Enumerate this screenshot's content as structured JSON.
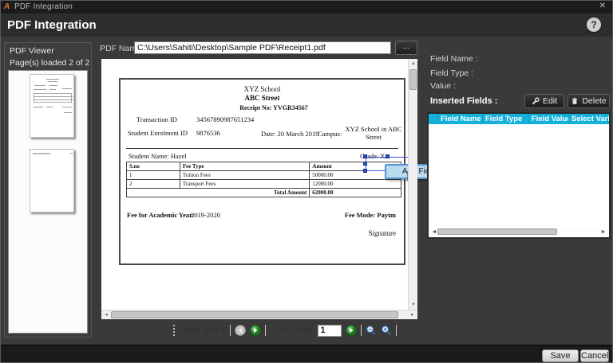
{
  "window": {
    "title": "PDF Integration",
    "close_glyph": "✕"
  },
  "header": {
    "title": "PDF Integration",
    "help_glyph": "?"
  },
  "sidebar": {
    "title": "PDF Viewer",
    "pages_loaded": "Page(s) loaded 2 of 2"
  },
  "pdf_name": {
    "label": "PDF Name:",
    "value": "C:\\Users\\Sahiti\\Desktop\\Sample PDF\\Receipt1.pdf",
    "browse_label": "..."
  },
  "document": {
    "school": "XYZ School",
    "street": "ABC Street",
    "receipt_no": "Receipt No: YVGR34567",
    "transaction_id_label": "Transaction ID",
    "transaction_id_value": "34567890987651234",
    "enrolment_label": "Student Enrolment ID",
    "enrolment_value": "9876536",
    "date": "Date: 20 March 2019",
    "campus_label": "Campus:",
    "campus_value_line1": "XYZ School in ABC",
    "campus_value_line2": "Street",
    "student_name": "Student Name:  Hazel",
    "grade": "Grade: X",
    "table": {
      "headers": [
        "S.no",
        "Fee Type",
        "Amount"
      ],
      "rows": [
        [
          "1",
          "Tuition Fees",
          "50000.00"
        ],
        [
          "2",
          "Transport Fees",
          "12000.00"
        ]
      ],
      "total_label": "Total Amount",
      "total_value": "62000.00"
    },
    "academic_year_label": "Fee for Academic Year:",
    "academic_year_value": "2019-2020",
    "fee_mode": "Fee Mode: Paytm",
    "signature": "Signature"
  },
  "add_field_popup": {
    "label": "Add Field"
  },
  "pager": {
    "page_label": "Page 1 of 2",
    "goto_label": "Go to page",
    "goto_value": "1"
  },
  "fields_panel": {
    "field_name_label": "Field Name :",
    "field_type_label": "Field Type :",
    "value_label": "Value :",
    "inserted_label": "Inserted Fields :",
    "edit_label": "Edit",
    "delete_label": "Delete",
    "columns": [
      "",
      "Field Name",
      "Field Type",
      "Field Value",
      "Select Varia"
    ]
  },
  "footer": {
    "save_label": "Save",
    "cancel_label": "Cancel"
  },
  "scroll_glyphs": {
    "up": "▲",
    "down": "▼",
    "left": "◄",
    "right": "►"
  },
  "colors": {
    "accent_cyan": "#14b1da",
    "selection_blue": "#2a50d8",
    "tooltip_bg": "#badaf0",
    "tooltip_border": "#5694cd",
    "go_green": "#2e9e2e",
    "logo_orange": "#e87722"
  }
}
